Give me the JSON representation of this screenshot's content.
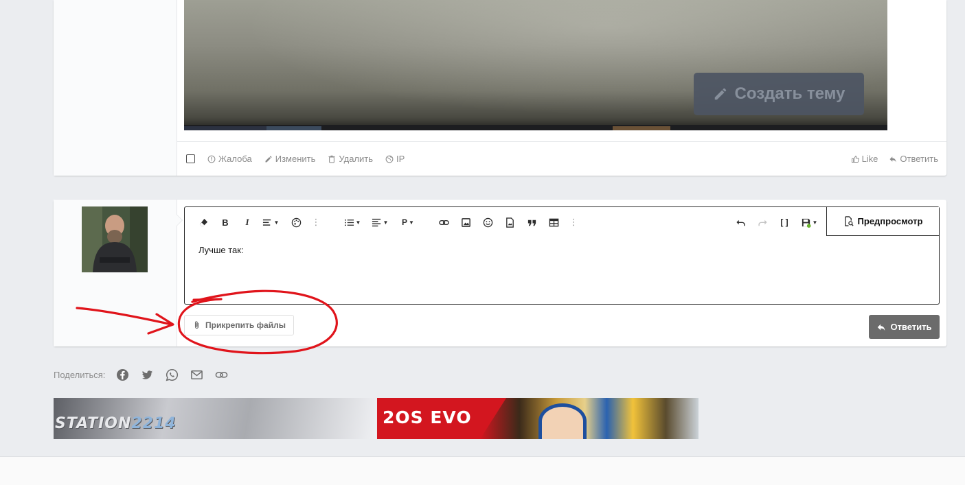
{
  "post": {
    "screenshot_button_label": "Создать тему",
    "actions_left": [
      {
        "icon": "warning-circle-icon",
        "label": "Жалоба"
      },
      {
        "icon": "pencil-icon",
        "label": "Изменить"
      },
      {
        "icon": "trash-icon",
        "label": "Удалить"
      },
      {
        "icon": "globe-icon",
        "label": "IP"
      }
    ],
    "actions_right": [
      {
        "icon": "thumbs-up-icon",
        "label": "Like"
      },
      {
        "icon": "reply-icon",
        "label": "Ответить"
      }
    ]
  },
  "editor": {
    "content": "Лучше так:",
    "paragraph_label": "P",
    "preview_label": "Предпросмотр",
    "attach_label": "Прикрепить файлы",
    "submit_label": "Ответить"
  },
  "share": {
    "label": "Поделиться:",
    "icons": [
      "facebook-icon",
      "twitter-icon",
      "whatsapp-icon",
      "mail-icon",
      "link-icon"
    ]
  },
  "banners": {
    "left": {
      "text_a": "STATION",
      "text_b": "2214"
    },
    "right": {
      "text": "2OS EVO"
    }
  },
  "colors": {
    "page_bg": "#ebedf0",
    "annotation_red": "#e0141b",
    "submit_bg": "#6b6b6b"
  }
}
